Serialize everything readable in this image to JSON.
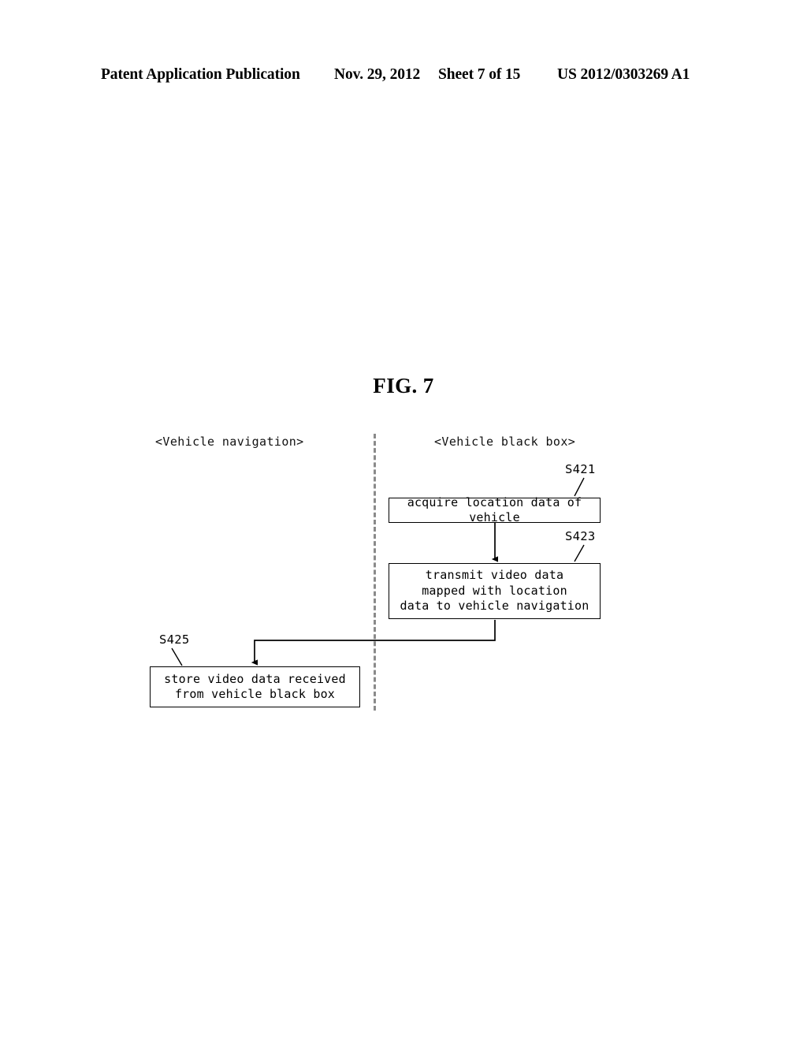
{
  "header": {
    "publication": "Patent Application Publication",
    "date": "Nov. 29, 2012",
    "sheet": "Sheet 7 of 15",
    "doc_number": "US 2012/0303269 A1"
  },
  "figure": {
    "title": "FIG. 7"
  },
  "diagram": {
    "type": "flowchart",
    "lanes": [
      {
        "id": "navigation",
        "label": "<Vehicle navigation>"
      },
      {
        "id": "blackbox",
        "label": "<Vehicle black box>"
      }
    ],
    "divider": {
      "style": "dashed",
      "color": "#8a8a8a"
    },
    "steps": [
      {
        "ref": "S421",
        "lane": "blackbox",
        "text": "acquire location data of vehicle"
      },
      {
        "ref": "S423",
        "lane": "blackbox",
        "text": "transmit video data\nmapped with location\ndata to vehicle navigation"
      },
      {
        "ref": "S425",
        "lane": "navigation",
        "text": "store video data received\nfrom vehicle black box"
      }
    ],
    "flow": [
      {
        "from": "S421",
        "to": "S423",
        "style": "vertical-arrow"
      },
      {
        "from": "S423",
        "to": "S425",
        "style": "elbow-arrow-cross-lane"
      }
    ]
  }
}
